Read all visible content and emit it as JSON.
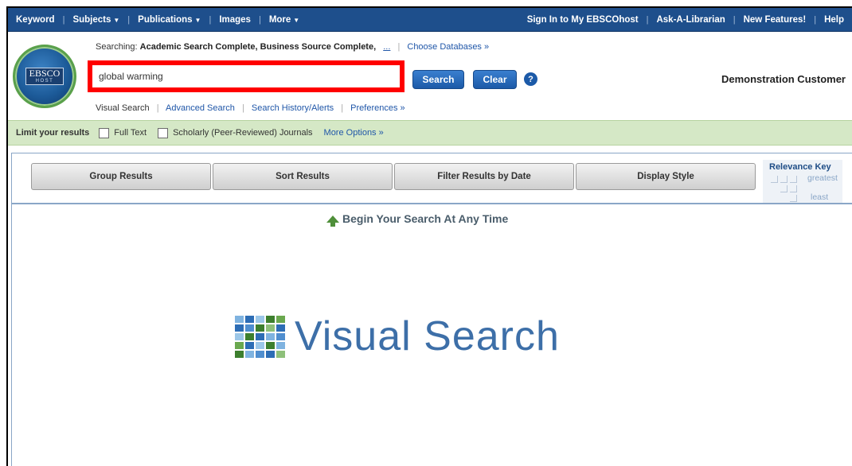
{
  "topnav": {
    "left": [
      "Keyword",
      "Subjects",
      "Publications",
      "Images",
      "More"
    ],
    "right": [
      "Sign In to My EBSCOhost",
      "Ask-A-Librarian",
      "New Features!",
      "Help"
    ]
  },
  "logo": {
    "text": "EBSCO",
    "sub": "HOST"
  },
  "header": {
    "searching_label": "Searching:",
    "databases": "Academic Search Complete, Business Source Complete,",
    "ellipsis": "...",
    "choose_databases": "Choose Databases »",
    "search_value": "global warming",
    "search_button": "Search",
    "clear_button": "Clear",
    "help_icon": "?",
    "customer": "Demonstration Customer"
  },
  "sublinks": {
    "visual": "Visual Search",
    "advanced": "Advanced Search",
    "history": "Search History/Alerts",
    "preferences": "Preferences »"
  },
  "limit": {
    "title": "Limit your results",
    "full_text": "Full Text",
    "scholarly": "Scholarly (Peer-Reviewed) Journals",
    "more": "More Options »"
  },
  "toolbar": [
    "Group Results",
    "Sort Results",
    "Filter Results by Date",
    "Display Style"
  ],
  "relevance": {
    "title": "Relevance Key",
    "greatest": "greatest",
    "least": "least"
  },
  "main": {
    "begin": "Begin Your Search At Any Time",
    "vs_title": "Visual Search"
  },
  "colors": {
    "nav": "#1e4f8c",
    "limit_bar": "#d5e8c6",
    "highlight": "#ff0000",
    "button": "#1c5aa8"
  }
}
